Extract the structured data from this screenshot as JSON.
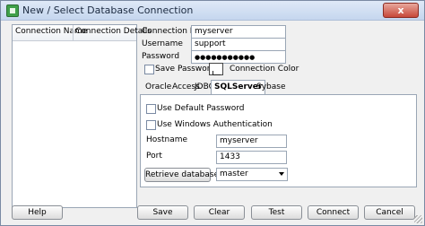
{
  "window": {
    "title": "New / Select Database Connection",
    "close_label": "x"
  },
  "connections_list": {
    "headers": [
      "Connection Name",
      "Connection Details"
    ]
  },
  "form": {
    "connection_name_label": "Connection Name",
    "connection_name_value": "myserver",
    "username_label": "Username",
    "username_value": "support",
    "password_label": "Password",
    "password_value": "●●●●●●●●●●●",
    "save_password_label": "Save Password",
    "connection_color_label": "Connection Color"
  },
  "tabs": [
    {
      "label": "Oracle"
    },
    {
      "label": "Access"
    },
    {
      "label": "JDBC"
    },
    {
      "label": "SQLServer"
    },
    {
      "label": "Sybase"
    }
  ],
  "active_tab": "SQLServer",
  "sqlserver": {
    "use_default_password_label": "Use Default Password",
    "use_windows_auth_label": "Use Windows Authentication",
    "hostname_label": "Hostname",
    "hostname_value": "myserver",
    "port_label": "Port",
    "port_value": "1433",
    "retrieve_database_label": "Retrieve database",
    "database_value": "master"
  },
  "footer": {
    "help": "Help",
    "save": "Save",
    "clear": "Clear",
    "test": "Test",
    "connect": "Connect",
    "cancel": "Cancel"
  }
}
